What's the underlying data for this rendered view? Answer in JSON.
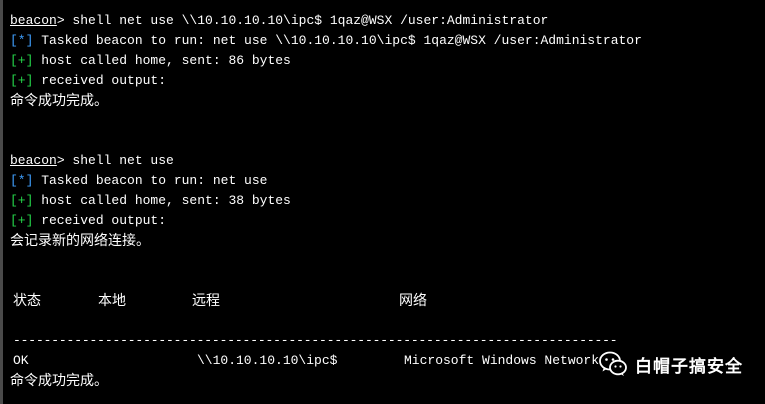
{
  "session1": {
    "prompt": "beacon",
    "command": "> shell net use \\\\10.10.10.10\\ipc$ 1qaz@WSX /user:Administrator",
    "tasked_tag": "[*]",
    "tasked_text": " Tasked beacon to run: net use \\\\10.10.10.10\\ipc$ 1qaz@WSX /user:Administrator",
    "sent_tag": "[+]",
    "sent_text": " host called home, sent: 86 bytes",
    "recv_tag": "[+]",
    "recv_text": " received output:",
    "output": "命令成功完成。"
  },
  "session2": {
    "prompt": "beacon",
    "command": "> shell net use",
    "tasked_tag": "[*]",
    "tasked_text": " Tasked beacon to run: net use",
    "sent_tag": "[+]",
    "sent_text": " host called home, sent: 38 bytes",
    "recv_tag": "[+]",
    "recv_text": " received output:",
    "output": "会记录新的网络连接。",
    "table": {
      "headers": [
        "状态",
        "本地",
        "远程",
        "网络"
      ],
      "separator": "-------------------------------------------------------------------------------",
      "rows": [
        {
          "status": "OK",
          "local": "",
          "remote": "\\\\10.10.10.10\\ipc$",
          "network": "Microsoft Windows Network"
        }
      ]
    },
    "final_output": "命令成功完成。"
  },
  "watermark": {
    "text": "白帽子搞安全",
    "icon": "wechat-icon"
  },
  "colors": {
    "background": "#000000",
    "text": "#ffffff",
    "info_tag": "#3fa0ff",
    "ok_tag": "#25d64a"
  }
}
